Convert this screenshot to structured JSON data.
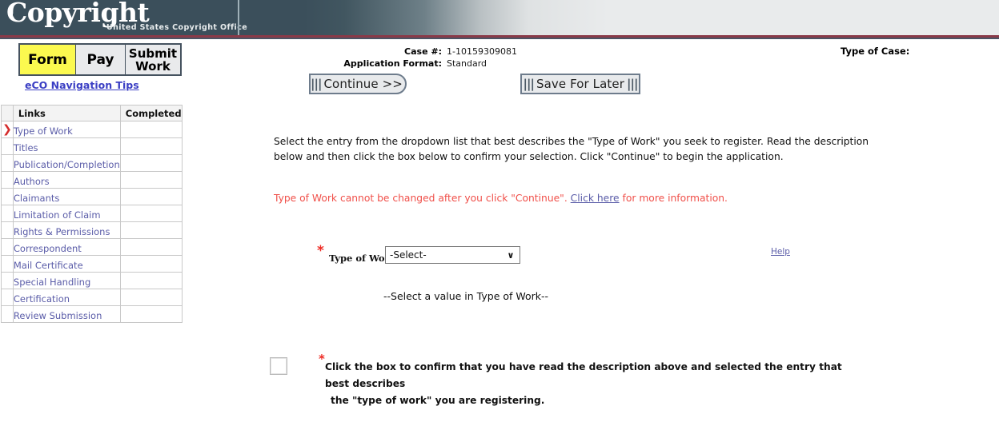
{
  "masthead": {
    "logo_word": "Copyright",
    "logo_subtitle": "United States Copyright Office",
    "copyright_ring_icon": "copyright-c-ring-icon"
  },
  "tabs": [
    {
      "label": "Form",
      "active": true
    },
    {
      "label": "Pay",
      "active": false
    },
    {
      "label": "Submit Work",
      "active": false
    }
  ],
  "nav_tips_link": "eCO Navigation Tips",
  "sidebar": {
    "headers": {
      "marker": "",
      "links": "Links",
      "completed": "Completed"
    },
    "current_marker_icon": "red-arrow-marker-icon",
    "current_marker_glyph": "❯",
    "items": [
      {
        "label": "Type of Work",
        "current": true,
        "completed": ""
      },
      {
        "label": "Titles",
        "current": false,
        "completed": ""
      },
      {
        "label": "Publication/Completion",
        "current": false,
        "completed": ""
      },
      {
        "label": "Authors",
        "current": false,
        "completed": ""
      },
      {
        "label": "Claimants",
        "current": false,
        "completed": ""
      },
      {
        "label": "Limitation of Claim",
        "current": false,
        "completed": ""
      },
      {
        "label": "Rights & Permissions",
        "current": false,
        "completed": ""
      },
      {
        "label": "Correspondent",
        "current": false,
        "completed": ""
      },
      {
        "label": "Mail Certificate",
        "current": false,
        "completed": ""
      },
      {
        "label": "Special Handling",
        "current": false,
        "completed": ""
      },
      {
        "label": "Certification",
        "current": false,
        "completed": ""
      },
      {
        "label": "Review Submission",
        "current": false,
        "completed": ""
      }
    ]
  },
  "case_info": {
    "case_number_label": "Case #:",
    "case_number_value": "1-10159309081",
    "application_format_label": "Application Format:",
    "application_format_value": "Standard",
    "type_of_case_label": "Type of Case:",
    "type_of_case_value": ""
  },
  "toolbar": {
    "continue_label": "Continue >>",
    "save_label": "Save For Later",
    "bar_glyph": "|||"
  },
  "main": {
    "instructions": "Select the entry from the dropdown list that best describes the \"Type of Work\" you seek to register. Read the description below and then click the box below to confirm your selection. Click \"Continue\" to begin the application.",
    "warning_before": "Type of Work cannot be changed after you click \"Continue\". ",
    "warning_link": "Click here",
    "warning_after": " for more information.",
    "type_of_work": {
      "required_marker": "*",
      "label": "Type of Work:",
      "selected_value": "-Select-",
      "options": [
        "-Select-"
      ],
      "chevron_icon": "chevron-down-icon",
      "chevron_glyph": "∨",
      "help_label": "Help"
    },
    "select_note": "--Select a value in Type of Work--",
    "confirm": {
      "required_marker": "*",
      "checked": false,
      "line1": "Click the box to confirm that you have read the description above and selected the entry that best describes",
      "line2": "the \"type of work\" you are registering."
    }
  },
  "colors": {
    "masthead_dark": "#3b4f5b",
    "masthead_light": "#e9ebec",
    "rule_red": "#8a3a48",
    "active_tab_yellow": "#fbf94f",
    "link_purple": "#5a5ca8",
    "warning_red": "#f0504a",
    "asterisk_red": "#ee2b24",
    "marker_red": "#d42b2b"
  }
}
